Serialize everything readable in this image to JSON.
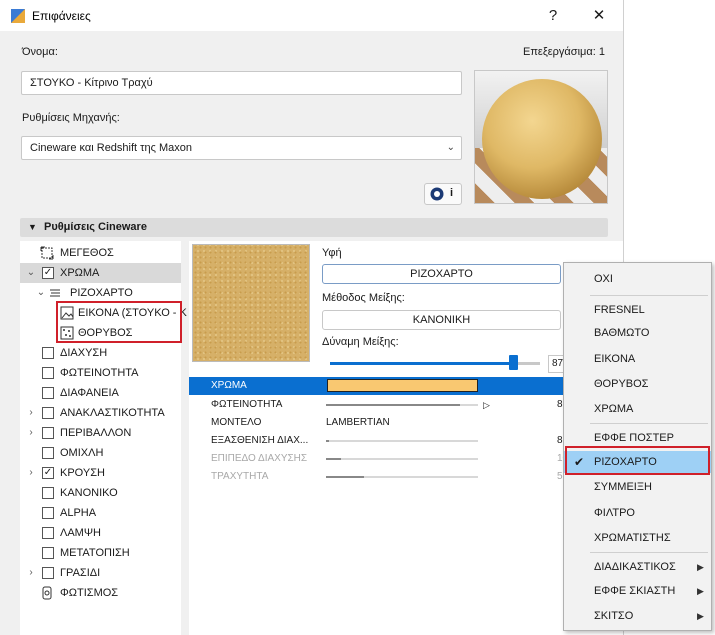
{
  "window": {
    "title": "Επιφάνειες",
    "help": "?",
    "close": "✕"
  },
  "name_label": "Όνομα:",
  "edit_count": "Επεξεργάσιμα: 1",
  "name_value": "ΣΤΟΥΚΟ - Κίτρινο Τραχύ",
  "engine_label": "Ρυθμίσεις Μηχανής:",
  "engine_value": "Cineware και Redshift της Maxon",
  "info_button": "i",
  "section_title": "Ρυθμίσεις Cineware",
  "tree": [
    {
      "label": "ΜΕΓΕΘΟΣ"
    },
    {
      "label": "ΧΡΩΜΑ",
      "checked": true,
      "selected": true
    },
    {
      "label": "ΡΙΖΟΧΑΡΤΟ"
    },
    {
      "label": "ΕΙΚΟΝΑ (ΣΤΟΥΚΟ - Κ"
    },
    {
      "label": "ΘΟΡΥΒΟΣ"
    },
    {
      "label": "ΔΙΑΧΥΣΗ"
    },
    {
      "label": "ΦΩΤΕΙΝΟΤΗΤΑ"
    },
    {
      "label": "ΔΙΑΦΑΝΕΙΑ"
    },
    {
      "label": "ΑΝΑΚΛΑΣΤΙΚΟΤΗΤΑ"
    },
    {
      "label": "ΠΕΡΙΒΑΛΛΟΝ"
    },
    {
      "label": "ΟΜΙΧΛΗ"
    },
    {
      "label": "ΚΡΟΥΣΗ",
      "checked": true
    },
    {
      "label": "ΚΑΝΟΝΙΚΟ"
    },
    {
      "label": "ALPHA"
    },
    {
      "label": "ΛΑΜΨΗ"
    },
    {
      "label": "ΜΕΤΑΤΟΠΙΣΗ"
    },
    {
      "label": "ΓΡΑΣΙΔΙ"
    },
    {
      "label": "ΦΩΤΙΣΜΟΣ"
    }
  ],
  "texture_label": "Υφή",
  "texture_value": "ΡΙΖΟΧΑΡΤΟ",
  "blend_mode_label": "Μέθοδος Μείξης:",
  "blend_mode_value": "ΚΑΝΟΝΙΚΗ",
  "blend_strength_label": "Δύναμη Μείξης:",
  "blend_strength_value": "87",
  "blend_strength": 0.87,
  "properties": [
    {
      "name": "ΧΡΩΜΑ",
      "selected": true,
      "color": "#f9c871"
    },
    {
      "name": "ΦΩΤΕΙΝΟΤΗΤΑ",
      "value": "8",
      "level": 0.88
    },
    {
      "name": "ΜΟΝΤΕΛΟ",
      "value_text": "LAMBERTIAN"
    },
    {
      "name": "ΕΞΑΣΘΕΝΙΣΗ ΔΙΑΧ...",
      "value": "8",
      "level": 0.02
    },
    {
      "name": "ΕΠΙΠΕΔΟ ΔΙΑΧΥΣΗΣ",
      "value": "10",
      "level": 0.1,
      "disabled": true
    },
    {
      "name": "ΤΡΑΧΥΤΗΤΑ",
      "value": "5",
      "level": 0.25,
      "disabled": true
    }
  ],
  "menu": {
    "items": [
      {
        "label": "ΟΧΙ"
      },
      {
        "label": "FRESNEL"
      },
      {
        "label": "ΒΑΘΜΩΤΟ"
      },
      {
        "label": "ΕΙΚΟΝΑ"
      },
      {
        "label": "ΘΟΡΥΒΟΣ"
      },
      {
        "label": "ΧΡΩΜΑ"
      },
      {
        "label": "ΕΦΦΕ ΠΟΣΤΕΡ"
      },
      {
        "label": "ΡΙΖΟΧΑΡΤΟ",
        "checked": true
      },
      {
        "label": "ΣΥΜΜΕΙΞΗ"
      },
      {
        "label": "ΦΙΛΤΡΟ"
      },
      {
        "label": "ΧΡΩΜΑΤΙΣΤΗΣ"
      },
      {
        "label": "ΔΙΑΔΙΚΑΣΤΙΚΟΣ",
        "submenu": true
      },
      {
        "label": "ΕΦΦΕ ΣΚΙΑΣΤΗ",
        "submenu": true
      },
      {
        "label": "ΣΚΙΤΣΟ",
        "submenu": true
      }
    ],
    "check_glyph": "✔",
    "submenu_glyph": "▶"
  },
  "colors": {
    "accent": "#0a6fd0",
    "highlight": "#9ed0f5",
    "annotation": "#d0202a"
  }
}
